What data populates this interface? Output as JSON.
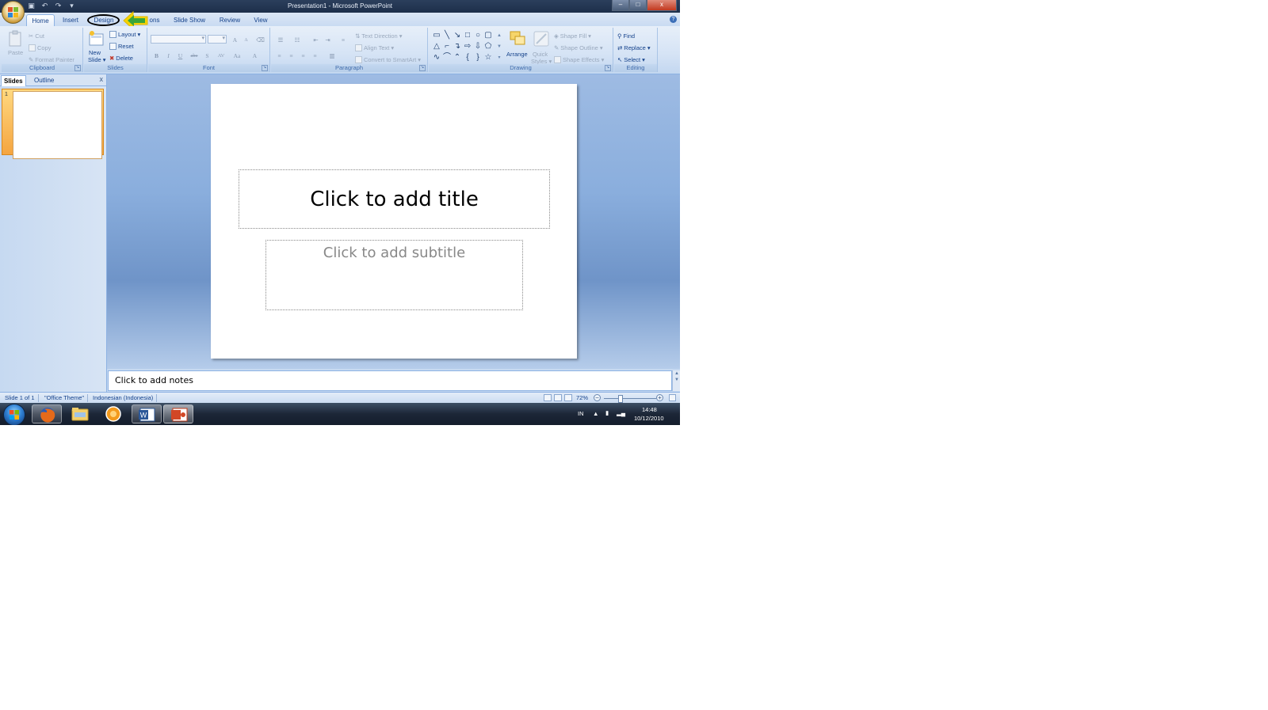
{
  "window": {
    "title": "Presentation1 - Microsoft PowerPoint",
    "controls": [
      "–",
      "□",
      "x"
    ]
  },
  "tabs": [
    {
      "label": "Home",
      "active": true
    },
    {
      "label": "Insert",
      "active": false
    },
    {
      "label": "Design",
      "active": false
    },
    {
      "label": "ons",
      "active": false
    },
    {
      "label": "Slide Show",
      "active": false
    },
    {
      "label": "Review",
      "active": false
    },
    {
      "label": "View",
      "active": false
    }
  ],
  "ribbon": {
    "clipboard": {
      "label": "Clipboard",
      "paste": "Paste",
      "cut": "Cut",
      "copy": "Copy",
      "format_painter": "Format Painter"
    },
    "slides": {
      "label": "Slides",
      "new_slide": "New",
      "new_slide_2": "Slide",
      "layout": "Layout",
      "reset": "Reset",
      "delete": "Delete"
    },
    "font": {
      "label": "Font",
      "bold": "B",
      "italic": "I",
      "underline": "U",
      "strike": "abc",
      "shadow": "S",
      "spacing": "AV",
      "case": "Aa",
      "color": "A",
      "grow": "A",
      "shrink": "A"
    },
    "paragraph": {
      "label": "Paragraph",
      "text_direction": "Text Direction",
      "align_text": "Align Text",
      "convert_smartart": "Convert to SmartArt"
    },
    "drawing": {
      "label": "Drawing",
      "arrange": "Arrange",
      "quick_styles": "Quick",
      "quick_styles_2": "Styles",
      "shape_fill": "Shape Fill",
      "shape_outline": "Shape Outline",
      "shape_effects": "Shape Effects"
    },
    "editing": {
      "label": "Editing",
      "find": "Find",
      "replace": "Replace",
      "select": "Select"
    }
  },
  "left_pane": {
    "tabs": [
      "Slides",
      "Outline"
    ],
    "close": "x",
    "thumbnail_number": "1"
  },
  "slide": {
    "title_placeholder": "Click to add title",
    "subtitle_placeholder": "Click to add subtitle"
  },
  "notes": {
    "placeholder": "Click to add notes"
  },
  "status_bar": {
    "slide_info": "Slide 1 of 1",
    "theme": "\"Office Theme\"",
    "language": "Indonesian (Indonesia)",
    "zoom": "72%"
  },
  "taskbar": {
    "language": "IN",
    "time": "14:48",
    "date": "10/12/2010"
  },
  "colors": {
    "ribbon_text": "#15428b",
    "annotation_arrow": "#f5d400",
    "annotation_arrow_inner": "#3aa53a"
  }
}
